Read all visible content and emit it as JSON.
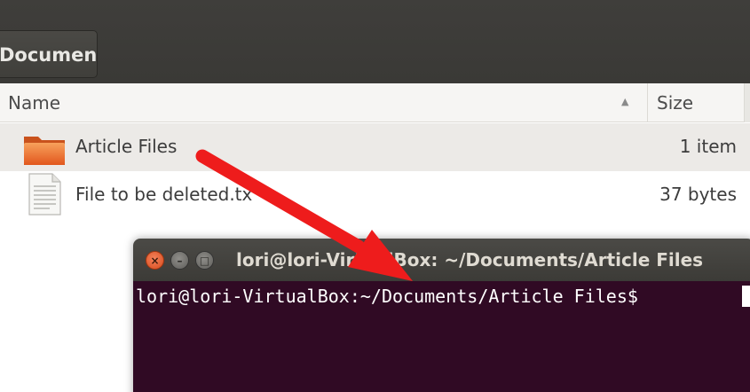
{
  "toolbar": {
    "path_button": "Documents"
  },
  "list_header": {
    "name_label": "Name",
    "size_label": "Size",
    "sort_indicator": "▲"
  },
  "files": [
    {
      "name": "Article Files",
      "size": "1 item",
      "icon": "folder-icon",
      "selected": true
    },
    {
      "name": "File to be deleted.tx",
      "size": "37 bytes",
      "icon": "text-file-icon",
      "selected": false
    }
  ],
  "terminal": {
    "title": "lori@lori-VirtualBox: ~/Documents/Article Files",
    "prompt": "lori@lori-VirtualBox:~/Documents/Article Files$ ",
    "window_buttons": {
      "close": "×",
      "minimize": "–",
      "maximize": "□"
    },
    "background_color": "#300a24"
  },
  "annotation": {
    "type": "arrow",
    "color": "#ee1c1c"
  }
}
